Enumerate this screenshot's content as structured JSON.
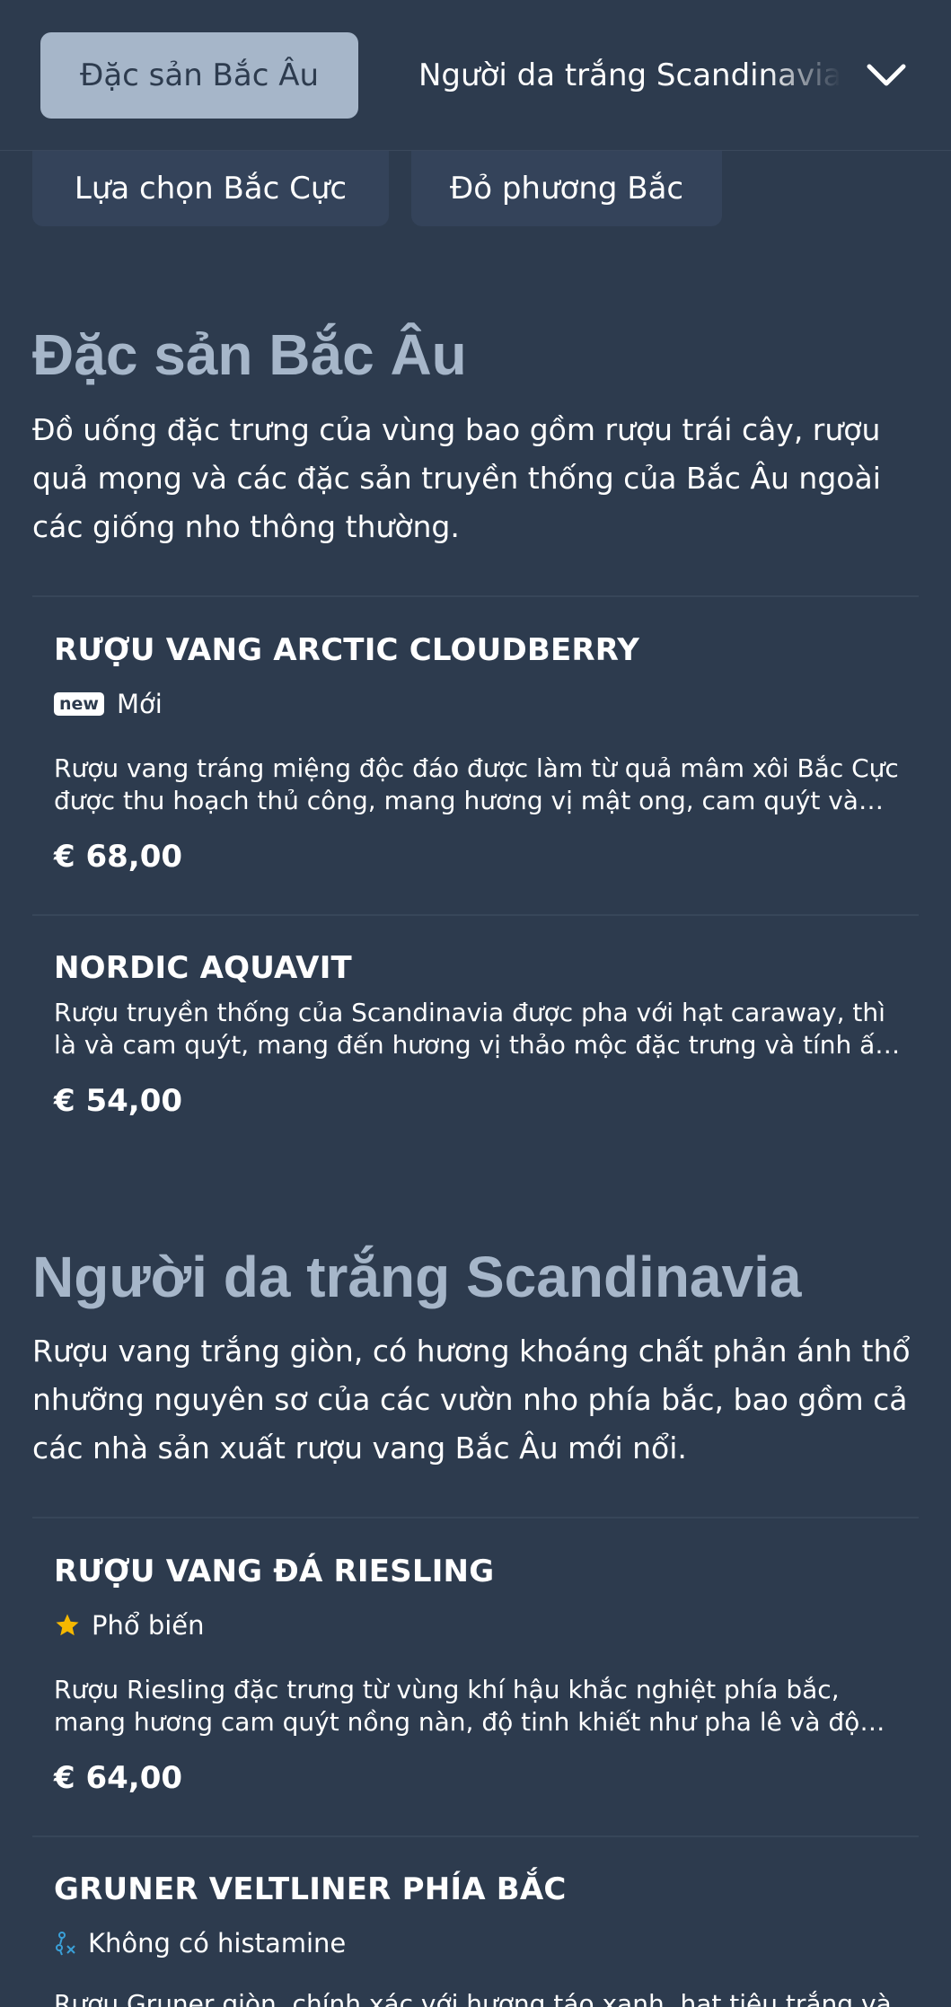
{
  "nav": {
    "active_tab": "Đặc sản Bắc Âu",
    "next_tab": "Người da trắng Scandinavia",
    "chips": [
      "Lựa chọn Bắc Cực",
      "Đỏ phương Bắc"
    ]
  },
  "sections": [
    {
      "title": "Đặc sản Bắc Âu",
      "description": "Đồ uống đặc trưng của vùng bao gồm rượu trái cây, rượu quả mọng và các đặc sản truyền thống của Bắc Âu ngoài các giống nho thông thường.",
      "items": [
        {
          "name": "RƯỢU VANG ARCTIC CLOUDBERRY",
          "badge": "new",
          "tag": "Mới",
          "description": "Rượu vang tráng miệng độc đáo được làm từ quả mâm xôi Bắc Cực được thu hoạch thủ công, mang hương vị mật ong, cam quýt và hương thơm đặc trưng.",
          "price": "€ 68,00"
        },
        {
          "name": "NORDIC AQUAVIT",
          "description": "Rượu truyền thống của Scandinavia được pha với hạt caraway, thì là và cam quýt, mang đến hương vị thảo mộc đặc trưng và tính ấm áp.",
          "price": "€ 54,00"
        }
      ]
    },
    {
      "title": "Người da trắng Scandinavia",
      "description": "Rượu vang trắng giòn, có hương khoáng chất phản ánh thổ nhưỡng nguyên sơ của các vườn nho phía bắc, bao gồm cả các nhà sản xuất rượu vang Bắc Âu mới nổi.",
      "items": [
        {
          "name": "RƯỢU VANG ĐÁ RIESLING",
          "tag_icon": "star-icon",
          "tag": "Phổ biến",
          "description": "Rượu Riesling đặc trưng từ vùng khí hậu khắc nghiệt phía bắc, mang hương cam quýt nồng nàn, độ tinh khiết như pha lê và độ chua sảng khoái.",
          "price": "€ 64,00"
        },
        {
          "name": "GRUNER VELTLINER PHÍA BẮC",
          "tag_icon": "histamine-free-icon",
          "tag": "Không có histamine",
          "description": "Rượu Gruner giòn, chính xác với hương táo xanh, hạt tiêu trắng và khoáng chất.",
          "price": ""
        }
      ]
    }
  ],
  "colors": {
    "background": "#2d3b4e",
    "accent": "#a6b6c9",
    "card": "#34435a",
    "star": "#f5b800",
    "icon_blue": "#3aa0d8"
  }
}
